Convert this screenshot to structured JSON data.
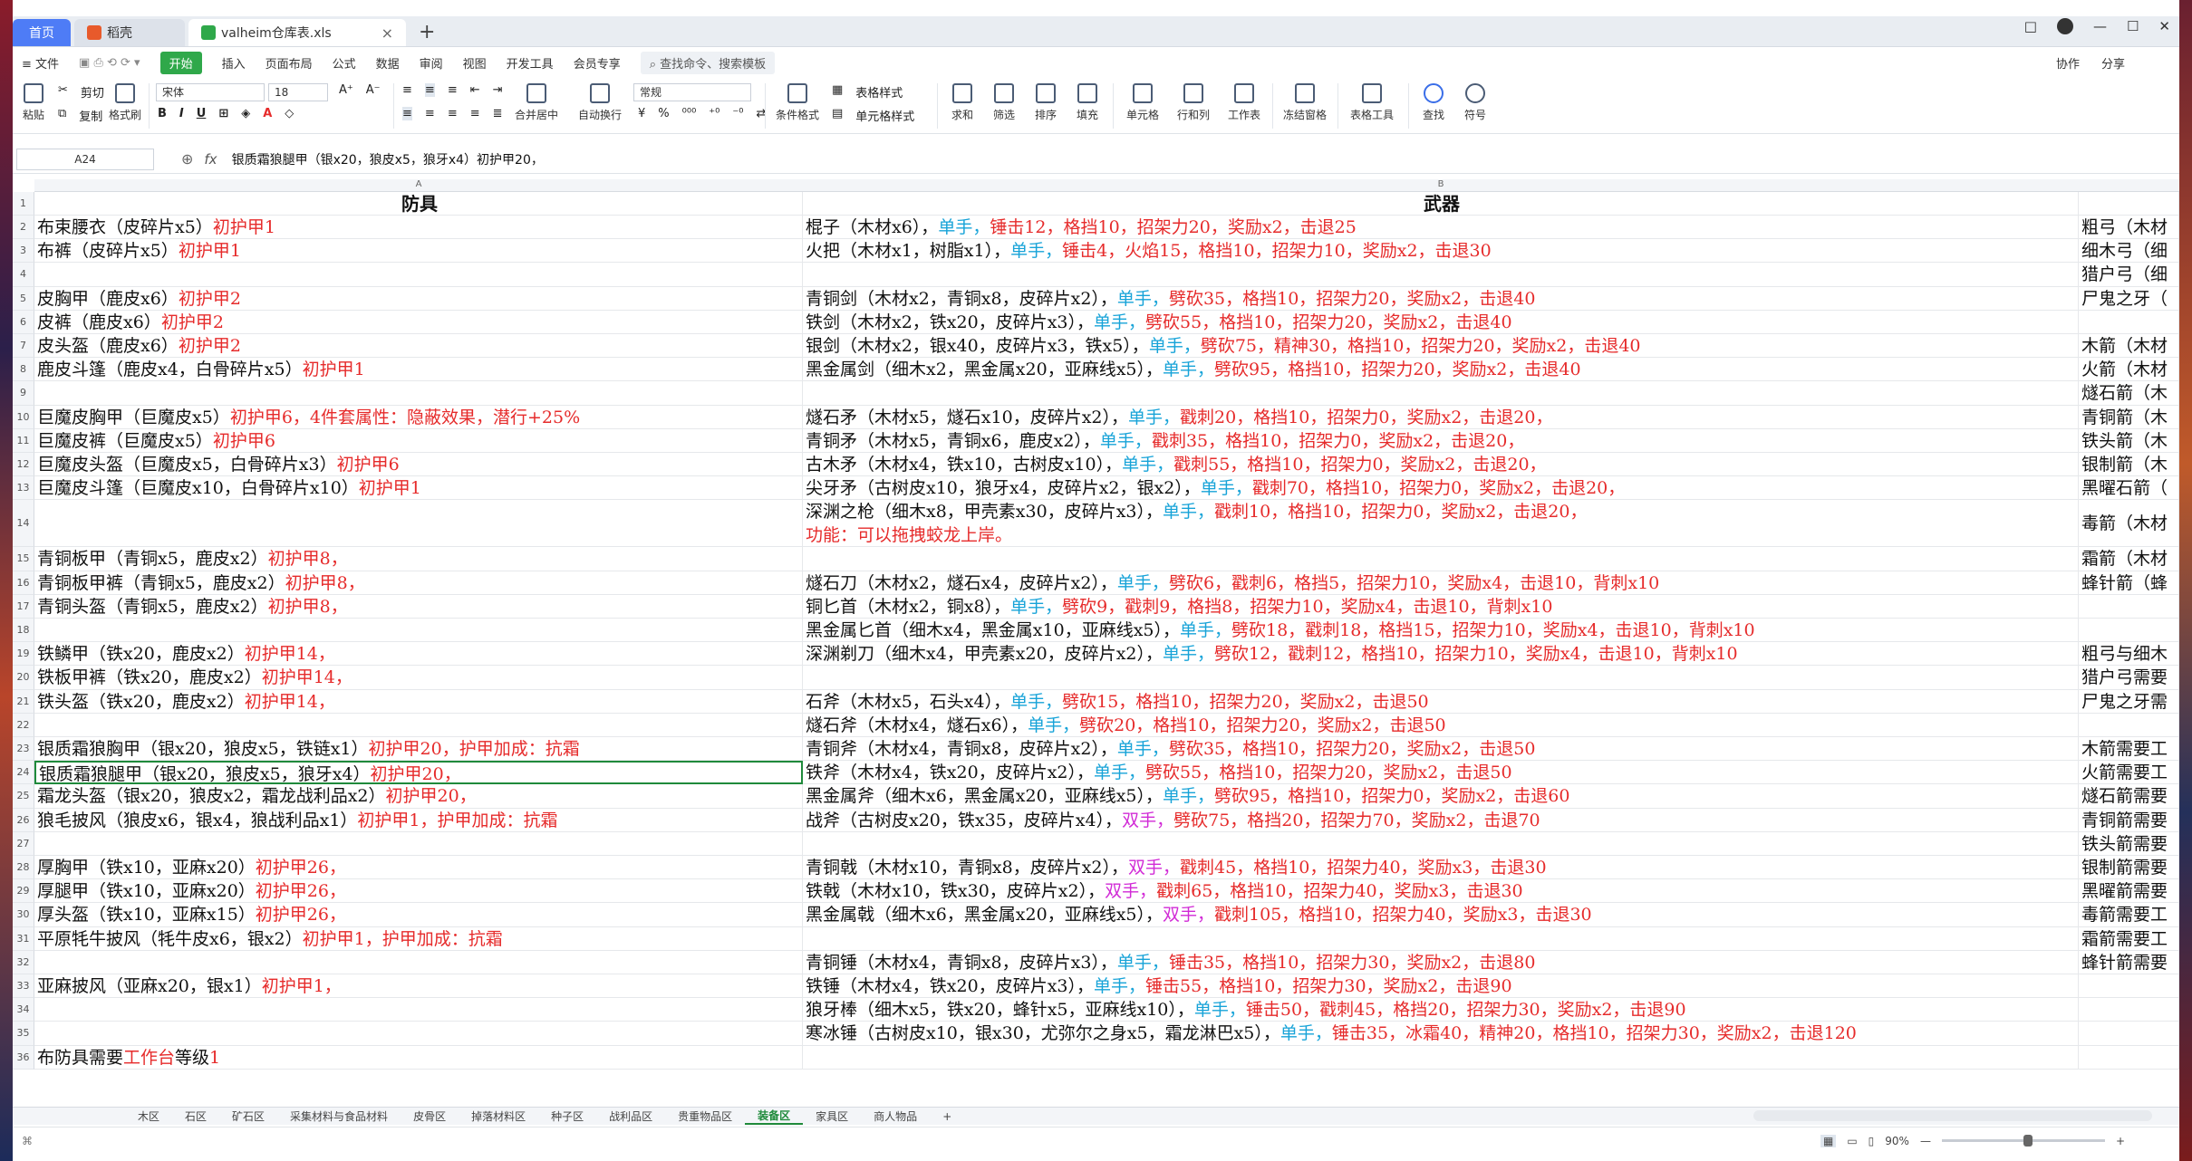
{
  "tabs": {
    "home": "首页",
    "dk": "稻壳",
    "file": "valheim仓库表.xls",
    "add": "+"
  },
  "window_controls": [
    "□",
    "—",
    "☐",
    "✕"
  ],
  "menu": {
    "file": "≡ 文件",
    "start": "开始",
    "items": [
      "插入",
      "页面布局",
      "公式",
      "数据",
      "审阅",
      "视图",
      "开发工具",
      "会员专享"
    ],
    "search": "查找命令、搜索模板",
    "right": [
      "协作",
      "分享"
    ]
  },
  "ribbon": {
    "paste": "粘贴",
    "cut": "剪切",
    "copy": "复制",
    "format_painter": "格式刷",
    "font": "宋体",
    "size": "18",
    "number_format": "常规",
    "merge": "合并居中",
    "wrap": "自动换行",
    "cond": "条件格式",
    "table_style": "表格样式",
    "cell_style": "单元格样式",
    "sum": "求和",
    "filter": "筛选",
    "sort": "排序",
    "fill": "填充",
    "cell": "单元格",
    "rowcol": "行和列",
    "sheet": "工作表",
    "freeze": "冻结窗格",
    "tools": "表格工具",
    "find": "查找",
    "symbol": "符号"
  },
  "formula": {
    "cell": "A24",
    "fx": "fx",
    "content": "银质霜狼腿甲（银x20，狼皮x5，狼牙x4）初护甲20，"
  },
  "columns": [
    "A",
    "B"
  ],
  "headers": {
    "a": "防具",
    "b": "武器"
  },
  "rows": [
    {
      "n": "2",
      "a": [
        [
          "布束腰衣（皮碎片x5）",
          ""
        ],
        [
          "初护甲1",
          "r"
        ]
      ],
      "b": [
        [
          "棍子（木材x6），",
          ""
        ],
        [
          "单手，",
          "c"
        ],
        [
          "锤击12，格挡10，招架力20，奖励x2，击退25",
          "r"
        ]
      ],
      "c": "粗弓（木材"
    },
    {
      "n": "3",
      "a": [
        [
          "布裤（皮碎片x5）",
          ""
        ],
        [
          "初护甲1",
          "r"
        ]
      ],
      "b": [
        [
          "火把（木材x1，树脂x1），",
          ""
        ],
        [
          "单手，",
          "c"
        ],
        [
          "锤击4，火焰15，格挡10，招架力10，奖励x2，击退30",
          "r"
        ]
      ],
      "c": "细木弓（细"
    },
    {
      "n": "4",
      "a": [],
      "b": [],
      "c": "猎户弓（细"
    },
    {
      "n": "5",
      "a": [
        [
          "皮胸甲（鹿皮x6）",
          ""
        ],
        [
          "初护甲2",
          "r"
        ]
      ],
      "b": [
        [
          "青铜剑（木材x2，青铜x8，皮碎片x2），",
          ""
        ],
        [
          "单手，",
          "c"
        ],
        [
          "劈砍35，格挡10，招架力20，奖励x2，击退40",
          "r"
        ]
      ],
      "c": "尸鬼之牙（"
    },
    {
      "n": "6",
      "a": [
        [
          "皮裤（鹿皮x6）",
          ""
        ],
        [
          "初护甲2",
          "r"
        ]
      ],
      "b": [
        [
          "铁剑（木材x2，铁x20，皮碎片x3），",
          ""
        ],
        [
          "单手，",
          "c"
        ],
        [
          "劈砍55，格挡10，招架力20，奖励x2，击退40",
          "r"
        ]
      ],
      "c": ""
    },
    {
      "n": "7",
      "a": [
        [
          "皮头盔（鹿皮x6）",
          ""
        ],
        [
          "初护甲2",
          "r"
        ]
      ],
      "b": [
        [
          "银剑（木材x2，银x40，皮碎片x3，铁x5），",
          ""
        ],
        [
          "单手，",
          "c"
        ],
        [
          "劈砍75，精神30，格挡10，招架力20，奖励x2，击退40",
          "r"
        ]
      ],
      "c": "木箭（木材"
    },
    {
      "n": "8",
      "a": [
        [
          "鹿皮斗篷（鹿皮x4，白骨碎片x5）",
          ""
        ],
        [
          "初护甲1",
          "r"
        ]
      ],
      "b": [
        [
          "黑金属剑（细木x2，黑金属x20，亚麻线x5），",
          ""
        ],
        [
          "单手，",
          "c"
        ],
        [
          "劈砍95，格挡10，招架力20，奖励x2，击退40",
          "r"
        ]
      ],
      "c": "火箭（木材"
    },
    {
      "n": "9",
      "a": [],
      "b": [],
      "c": "燧石箭（木"
    },
    {
      "n": "10",
      "a": [
        [
          "巨魔皮胸甲（巨魔皮x5）",
          ""
        ],
        [
          "初护甲6，4件套属性：隐蔽效果，潜行+25%",
          "r"
        ]
      ],
      "b": [
        [
          "燧石矛（木材x5，燧石x10，皮碎片x2），",
          ""
        ],
        [
          "单手，",
          "c"
        ],
        [
          "戳刺20，格挡10，招架力0，奖励x2，击退20，",
          "r"
        ]
      ],
      "c": "青铜箭（木"
    },
    {
      "n": "11",
      "a": [
        [
          "巨魔皮裤（巨魔皮x5）",
          ""
        ],
        [
          "初护甲6",
          "r"
        ]
      ],
      "b": [
        [
          "青铜矛（木材x5，青铜x6，鹿皮x2），",
          ""
        ],
        [
          "单手，",
          "c"
        ],
        [
          "戳刺35，格挡10，招架力0，奖励x2，击退20，",
          "r"
        ]
      ],
      "c": "铁头箭（木"
    },
    {
      "n": "12",
      "a": [
        [
          "巨魔皮头盔（巨魔皮x5，白骨碎片x3）",
          ""
        ],
        [
          "初护甲6",
          "r"
        ]
      ],
      "b": [
        [
          "古木矛（木材x4，铁x10，古树皮x10），",
          ""
        ],
        [
          "单手，",
          "c"
        ],
        [
          "戳刺55，格挡10，招架力0，奖励x2，击退20，",
          "r"
        ]
      ],
      "c": "银制箭（木"
    },
    {
      "n": "13",
      "a": [
        [
          "巨魔皮斗篷（巨魔皮x10，白骨碎片x10）",
          ""
        ],
        [
          "初护甲1",
          "r"
        ]
      ],
      "b": [
        [
          "尖牙矛（古树皮x10，狼牙x4，皮碎片x2，银x2），",
          ""
        ],
        [
          "单手，",
          "c"
        ],
        [
          "戳刺70，格挡10，招架力0，奖励x2，击退20，",
          "r"
        ]
      ],
      "c": "黑曜石箭（"
    },
    {
      "n": "14",
      "tall": true,
      "a": [],
      "b": [
        [
          "深渊之枪（细木x8，甲壳素x30，皮碎片x3），",
          ""
        ],
        [
          "单手，",
          "c"
        ],
        [
          "戳刺10，格挡10，招架力0，奖励x2，击退20，",
          "r"
        ]
      ],
      "b2": [
        [
          "功能：可以拖拽蛟龙上岸。",
          "r"
        ]
      ],
      "c": "毒箭（木材"
    },
    {
      "n": "15",
      "a": [
        [
          "青铜板甲（青铜x5，鹿皮x2）",
          ""
        ],
        [
          "初护甲8，",
          "r"
        ]
      ],
      "b": [],
      "c": "霜箭（木材"
    },
    {
      "n": "16",
      "a": [
        [
          "青铜板甲裤（青铜x5，鹿皮x2）",
          ""
        ],
        [
          "初护甲8，",
          "r"
        ]
      ],
      "b": [
        [
          "燧石刀（木材x2，燧石x4，皮碎片x2），",
          ""
        ],
        [
          "单手，",
          "c"
        ],
        [
          "劈砍6，戳刺6，格挡5，招架力10，奖励x4，击退10，背刺x10",
          "r"
        ]
      ],
      "c": "蜂针箭（蜂"
    },
    {
      "n": "17",
      "a": [
        [
          "青铜头盔（青铜x5，鹿皮x2）",
          ""
        ],
        [
          "初护甲8，",
          "r"
        ]
      ],
      "b": [
        [
          "铜匕首（木材x2，铜x8），",
          ""
        ],
        [
          "单手，",
          "c"
        ],
        [
          "劈砍9，戳刺9，格挡8，招架力10，奖励x4，击退10，背刺x10",
          "r"
        ]
      ],
      "c": ""
    },
    {
      "n": "18",
      "a": [],
      "b": [
        [
          "黑金属匕首（细木x4，黑金属x10，亚麻线x5），",
          ""
        ],
        [
          "单手，",
          "c"
        ],
        [
          "劈砍18，戳刺18，格挡15，招架力10，奖励x4，击退10，背刺x10",
          "r"
        ]
      ],
      "c": ""
    },
    {
      "n": "19",
      "a": [
        [
          "铁鳞甲（铁x20，鹿皮x2）",
          ""
        ],
        [
          "初护甲14，",
          "r"
        ]
      ],
      "b": [
        [
          "深渊剃刀（细木x4，甲壳素x20，皮碎片x2），",
          ""
        ],
        [
          "单手，",
          "c"
        ],
        [
          "劈砍12，戳刺12，格挡10，招架力10，奖励x4，击退10，背刺x10",
          "r"
        ]
      ],
      "c": "粗弓与细木"
    },
    {
      "n": "20",
      "a": [
        [
          "铁板甲裤（铁x20，鹿皮x2）",
          ""
        ],
        [
          "初护甲14，",
          "r"
        ]
      ],
      "b": [],
      "c": "猎户弓需要"
    },
    {
      "n": "21",
      "a": [
        [
          "铁头盔（铁x20，鹿皮x2）",
          ""
        ],
        [
          "初护甲14，",
          "r"
        ]
      ],
      "b": [
        [
          "石斧（木材x5，石头x4），",
          ""
        ],
        [
          "单手，",
          "c"
        ],
        [
          "劈砍15，格挡10，招架力20，奖励x2，击退50",
          "r"
        ]
      ],
      "c": "尸鬼之牙需"
    },
    {
      "n": "22",
      "a": [],
      "b": [
        [
          "燧石斧（木材x4，燧石x6），",
          ""
        ],
        [
          "单手，",
          "c"
        ],
        [
          "劈砍20，格挡10，招架力20，奖励x2，击退50",
          "r"
        ]
      ],
      "c": ""
    },
    {
      "n": "23",
      "a": [
        [
          "银质霜狼胸甲（银x20，狼皮x5，铁链x1）",
          ""
        ],
        [
          "初护甲20，护甲加成：抗霜",
          "r"
        ]
      ],
      "b": [
        [
          "青铜斧（木材x4，青铜x8，皮碎片x2），",
          ""
        ],
        [
          "单手，",
          "c"
        ],
        [
          "劈砍35，格挡10，招架力20，奖励x2，击退50",
          "r"
        ]
      ],
      "c": "木箭需要工"
    },
    {
      "n": "24",
      "sel": true,
      "a": [
        [
          "银质霜狼腿甲（银x20，狼皮x5，狼牙x4）",
          ""
        ],
        [
          "初护甲20，",
          "r"
        ]
      ],
      "b": [
        [
          "铁斧（木材x4，铁x20，皮碎片x2），",
          ""
        ],
        [
          "单手，",
          "c"
        ],
        [
          "劈砍55，格挡10，招架力20，奖励x2，击退50",
          "r"
        ]
      ],
      "c": "火箭需要工"
    },
    {
      "n": "25",
      "a": [
        [
          "霜龙头盔（银x20，狼皮x2，霜龙战利品x2）",
          ""
        ],
        [
          "初护甲20，",
          "r"
        ]
      ],
      "b": [
        [
          "黑金属斧（细木x6，黑金属x20，亚麻线x5），",
          ""
        ],
        [
          "单手，",
          "c"
        ],
        [
          "劈砍95，格挡10，招架力0，奖励x2，击退60",
          "r"
        ]
      ],
      "c": "燧石箭需要"
    },
    {
      "n": "26",
      "a": [
        [
          "狼毛披风（狼皮x6，银x4，狼战利品x1）",
          ""
        ],
        [
          "初护甲1，护甲加成：抗霜",
          "r"
        ]
      ],
      "b": [
        [
          "战斧（古树皮x20，铁x35，皮碎片x4），",
          ""
        ],
        [
          "双手，",
          "m"
        ],
        [
          "劈砍75，格挡20，招架力70，奖励x2，击退70",
          "r"
        ]
      ],
      "c": "青铜箭需要"
    },
    {
      "n": "27",
      "a": [],
      "b": [],
      "c": "铁头箭需要"
    },
    {
      "n": "28",
      "a": [
        [
          "厚胸甲（铁x10，亚麻x20）",
          ""
        ],
        [
          "初护甲26，",
          "r"
        ]
      ],
      "b": [
        [
          "青铜戟（木材x10，青铜x8，皮碎片x2），",
          ""
        ],
        [
          "双手，",
          "m"
        ],
        [
          "戳刺45，格挡10，招架力40，奖励x3，击退30",
          "r"
        ]
      ],
      "c": "银制箭需要"
    },
    {
      "n": "29",
      "a": [
        [
          "厚腿甲（铁x10，亚麻x20）",
          ""
        ],
        [
          "初护甲26，",
          "r"
        ]
      ],
      "b": [
        [
          "铁戟（木材x10，铁x30，皮碎片x2），",
          ""
        ],
        [
          "双手，",
          "m"
        ],
        [
          "戳刺65，格挡10，招架力40，奖励x3，击退30",
          "r"
        ]
      ],
      "c": "黑曜箭需要"
    },
    {
      "n": "30",
      "a": [
        [
          "厚头盔（铁x10，亚麻x15）",
          ""
        ],
        [
          "初护甲26，",
          "r"
        ]
      ],
      "b": [
        [
          "黑金属戟（细木x6，黑金属x20，亚麻线x5），",
          ""
        ],
        [
          "双手，",
          "m"
        ],
        [
          "戳刺105，格挡10，招架力40，奖励x3，击退30",
          "r"
        ]
      ],
      "c": "毒箭需要工"
    },
    {
      "n": "31",
      "a": [
        [
          "平原牦牛披风（牦牛皮x6，银x2）",
          ""
        ],
        [
          "初护甲1，护甲加成：抗霜",
          "r"
        ]
      ],
      "b": [],
      "c": "霜箭需要工"
    },
    {
      "n": "32",
      "a": [],
      "b": [
        [
          "青铜锤（木材x4，青铜x8，皮碎片x3），",
          ""
        ],
        [
          "单手，",
          "c"
        ],
        [
          "锤击35，格挡10，招架力30，奖励x2，击退80",
          "r"
        ]
      ],
      "c": "蜂针箭需要"
    },
    {
      "n": "33",
      "a": [
        [
          "亚麻披风（亚麻x20，银x1）",
          ""
        ],
        [
          "初护甲1，",
          "r"
        ]
      ],
      "b": [
        [
          "铁锤（木材x4，铁x20，皮碎片x3），",
          ""
        ],
        [
          "单手，",
          "c"
        ],
        [
          "锤击55，格挡10，招架力30，奖励x2，击退90",
          "r"
        ]
      ],
      "c": ""
    },
    {
      "n": "34",
      "a": [],
      "b": [
        [
          "狼牙棒（细木x5，铁x20，蜂针x5，亚麻线x10），",
          ""
        ],
        [
          "单手，",
          "c"
        ],
        [
          "锤击50，戳刺45，格挡20，招架力30，奖励x2，击退90",
          "r"
        ]
      ],
      "c": ""
    },
    {
      "n": "35",
      "a": [],
      "b": [
        [
          "寒冰锤（古树皮x10，银x30，尤弥尔之身x5，霜龙淋巴x5），",
          ""
        ],
        [
          "单手，",
          "c"
        ],
        [
          "锤击35，冰霜40，精神20，格挡10，招架力30，奖励x2，击退120",
          "r"
        ]
      ],
      "c": ""
    },
    {
      "n": "36",
      "a": [
        [
          "布防具需要",
          ""
        ],
        [
          "工作台",
          "r"
        ],
        [
          "等级",
          ""
        ],
        [
          "1",
          "r"
        ]
      ],
      "b": [],
      "c": ""
    }
  ],
  "sheets": [
    "木区",
    "石区",
    "矿石区",
    "采集材料与食品材料",
    "皮骨区",
    "掉落材料区",
    "种子区",
    "战利品区",
    "贵重物品区",
    "装备区",
    "家具区",
    "商人物品"
  ],
  "active_sheet": "装备区",
  "status": {
    "zoom": "90%",
    "minus": "—",
    "plus": "+"
  }
}
